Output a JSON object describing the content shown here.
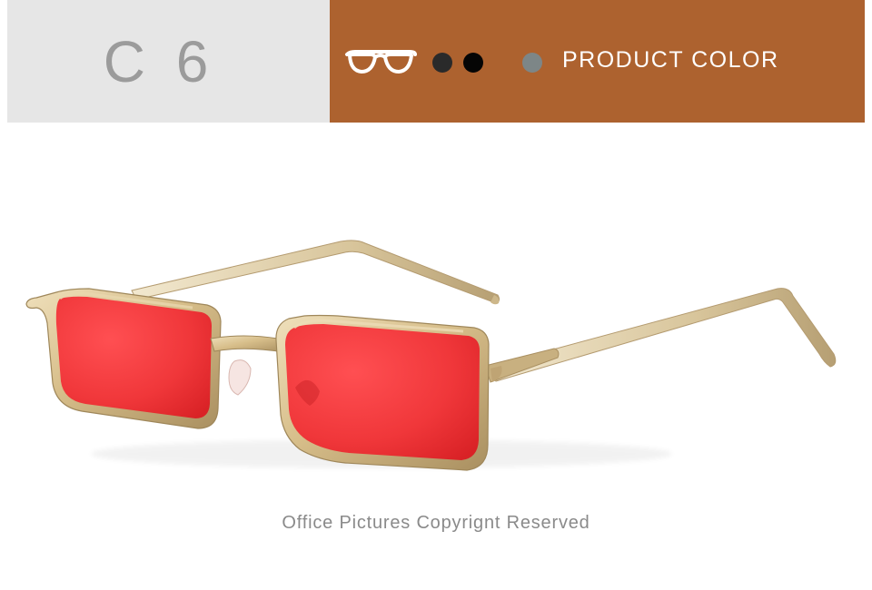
{
  "header": {
    "code": "C 6",
    "product_color_label": "PRODUCT COLOR",
    "panel_color": "#ad622f",
    "code_panel_color": "#e6e6e6",
    "swatches": [
      {
        "name": "dark-gray",
        "color": "#2a2a2a"
      },
      {
        "name": "black",
        "color": "#050505"
      },
      {
        "name": "gray",
        "color": "#7d8687"
      }
    ]
  },
  "product": {
    "lens_color": "#f0373a",
    "frame_color": "#d9c08d",
    "icons": [
      "glasses-icon",
      "sunglasses-image"
    ]
  },
  "footer": {
    "copyright": "Office Pictures Copyrignt Reserved"
  }
}
